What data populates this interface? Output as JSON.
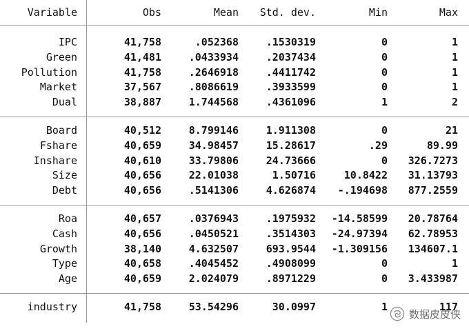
{
  "headers": {
    "variable": "Variable",
    "obs": "Obs",
    "mean": "Mean",
    "sd": "Std. dev.",
    "min": "Min",
    "max": "Max"
  },
  "groups": [
    {
      "rows": [
        {
          "var": "IPC",
          "obs": "41,758",
          "mean": ".052368",
          "sd": ".1530319",
          "min": "0",
          "max": "1"
        },
        {
          "var": "Green",
          "obs": "41,481",
          "mean": ".0433934",
          "sd": ".2037434",
          "min": "0",
          "max": "1"
        },
        {
          "var": "Pollution",
          "obs": "41,758",
          "mean": ".2646918",
          "sd": ".4411742",
          "min": "0",
          "max": "1"
        },
        {
          "var": "Market",
          "obs": "37,567",
          "mean": ".8086619",
          "sd": ".3933599",
          "min": "0",
          "max": "1"
        },
        {
          "var": "Dual",
          "obs": "38,887",
          "mean": "1.744568",
          "sd": ".4361096",
          "min": "1",
          "max": "2"
        }
      ]
    },
    {
      "rows": [
        {
          "var": "Board",
          "obs": "40,512",
          "mean": "8.799146",
          "sd": "1.911308",
          "min": "0",
          "max": "21"
        },
        {
          "var": "Fshare",
          "obs": "40,659",
          "mean": "34.98457",
          "sd": "15.28617",
          "min": ".29",
          "max": "89.99"
        },
        {
          "var": "Inshare",
          "obs": "40,610",
          "mean": "33.79806",
          "sd": "24.73666",
          "min": "0",
          "max": "326.7273"
        },
        {
          "var": "Size",
          "obs": "40,656",
          "mean": "22.01038",
          "sd": "1.50716",
          "min": "10.8422",
          "max": "31.13793"
        },
        {
          "var": "Debt",
          "obs": "40,656",
          "mean": ".5141306",
          "sd": "4.626874",
          "min": "-.194698",
          "max": "877.2559"
        }
      ]
    },
    {
      "rows": [
        {
          "var": "Roa",
          "obs": "40,657",
          "mean": ".0376943",
          "sd": ".1975932",
          "min": "-14.58599",
          "max": "20.78764"
        },
        {
          "var": "Cash",
          "obs": "40,656",
          "mean": ".0450521",
          "sd": ".3514303",
          "min": "-24.97394",
          "max": "62.78953"
        },
        {
          "var": "Growth",
          "obs": "38,140",
          "mean": "4.632507",
          "sd": "693.9544",
          "min": "-1.309156",
          "max": "134607.1"
        },
        {
          "var": "Type",
          "obs": "40,658",
          "mean": ".4045452",
          "sd": ".4908099",
          "min": "0",
          "max": "1"
        },
        {
          "var": "Age",
          "obs": "40,659",
          "mean": "2.024079",
          "sd": ".8971229",
          "min": "0",
          "max": "3.433987"
        }
      ]
    },
    {
      "rows": [
        {
          "var": "industry",
          "obs": "41,758",
          "mean": "53.54296",
          "sd": "30.0997",
          "min": "1",
          "max": "117"
        }
      ]
    }
  ],
  "watermark": {
    "text": "数据皮皮侠",
    "icon": "wechat-official-account-icon"
  }
}
